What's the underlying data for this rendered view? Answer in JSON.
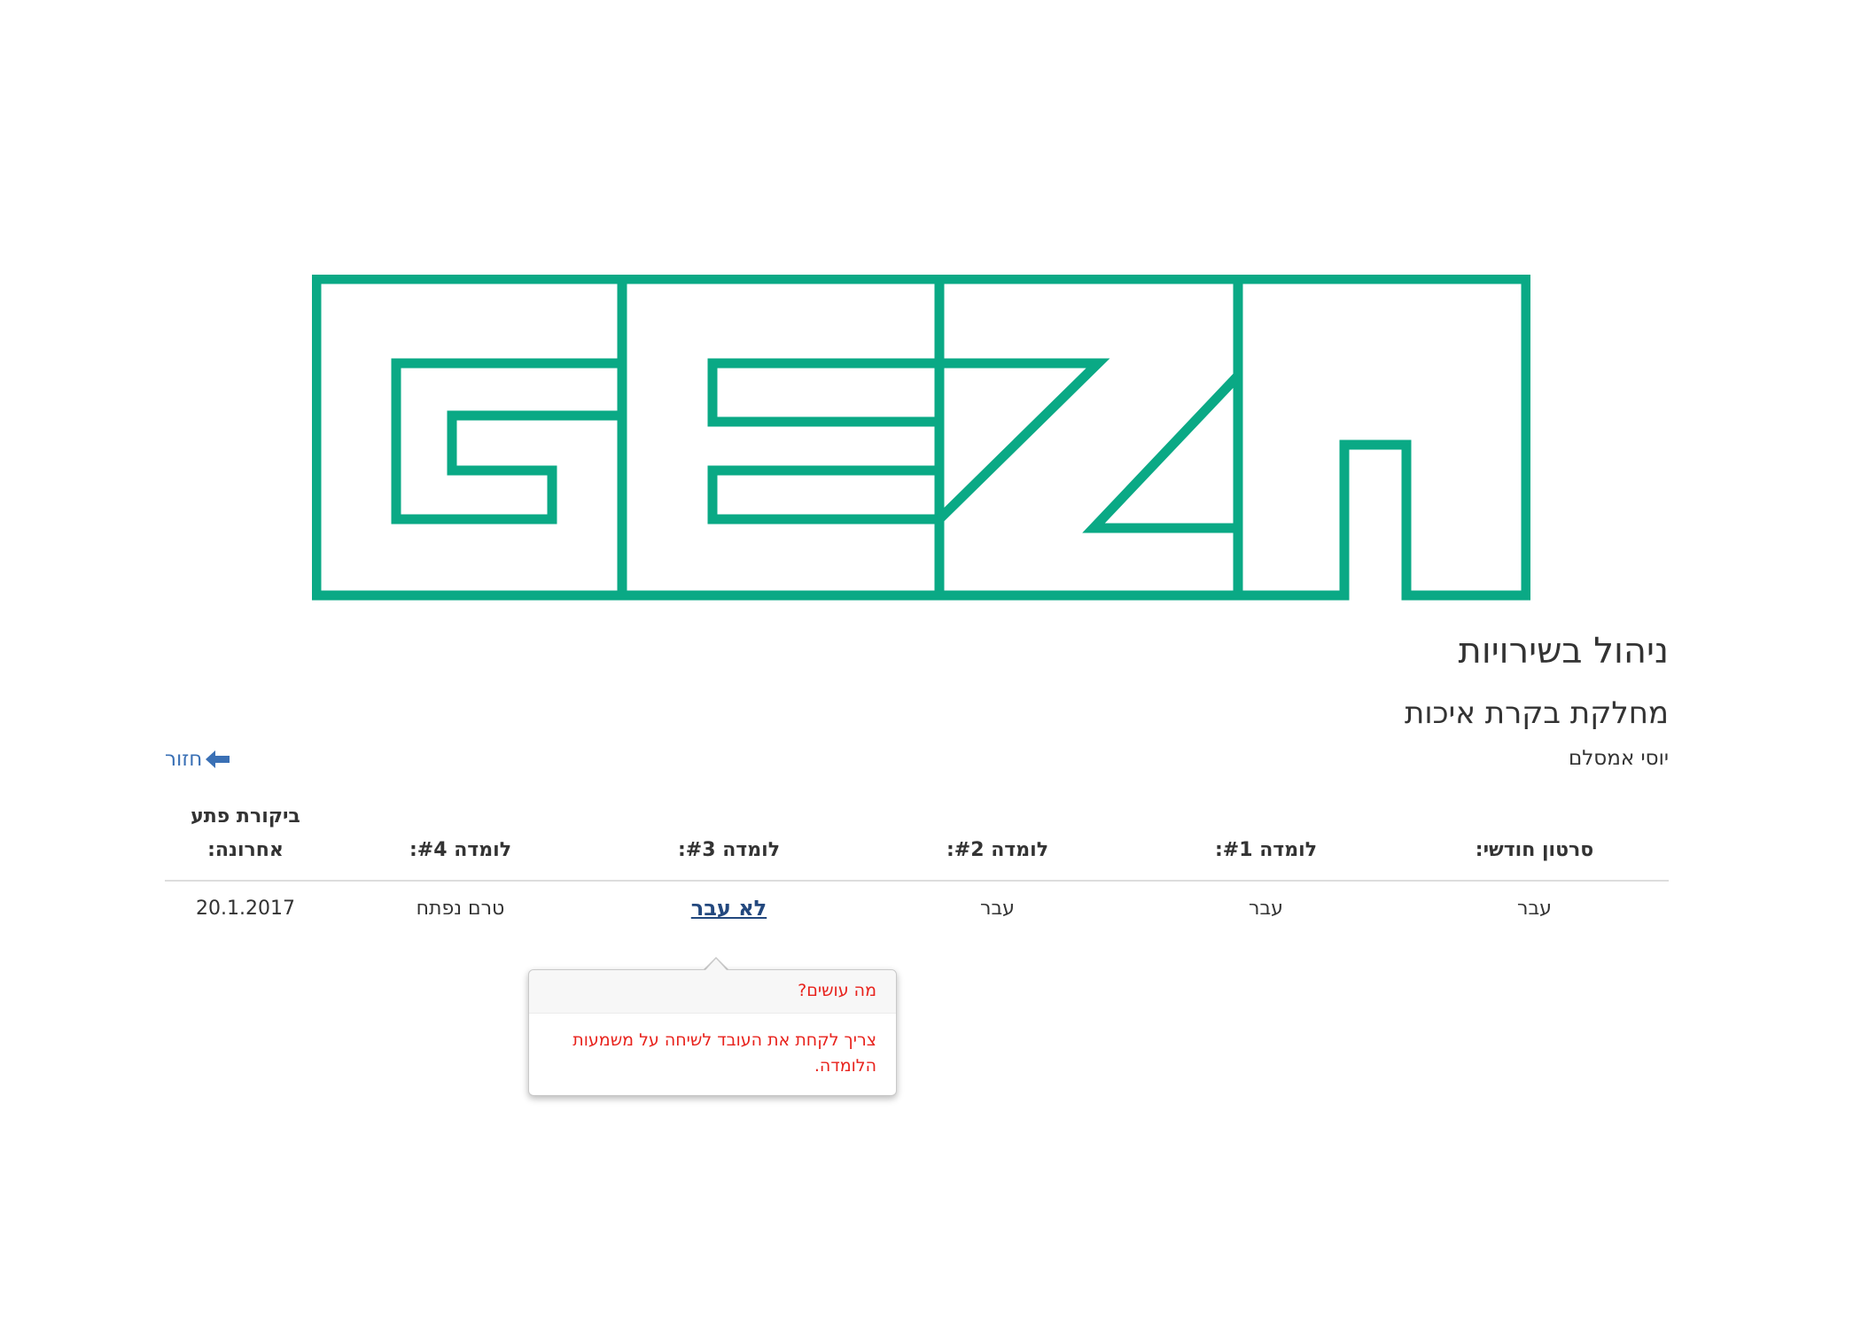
{
  "header": {
    "title": "ניהול בשירויות",
    "department": "מחלקת בקרת איכות",
    "employee_name": "יוסי אמסלם",
    "back_label": "חזור",
    "back_icon": "arrow-left-icon",
    "logo_color": "#0aa985"
  },
  "table": {
    "columns": [
      "סרטון חודשי:",
      "לומדה #1:",
      "לומדה #2:",
      "לומדה #3:",
      "לומדה #4:",
      "ביקורת פתע אחרונה:"
    ],
    "row": [
      "עבר",
      "עבר",
      "עבר",
      "לא עבר",
      "טרם נפתח",
      "20.1.2017"
    ]
  },
  "popover": {
    "title": "מה עושים?",
    "content": "צריך לקחת את העובד לשיחה על משמעות הלומדה.",
    "text_color": "#e8221c"
  }
}
